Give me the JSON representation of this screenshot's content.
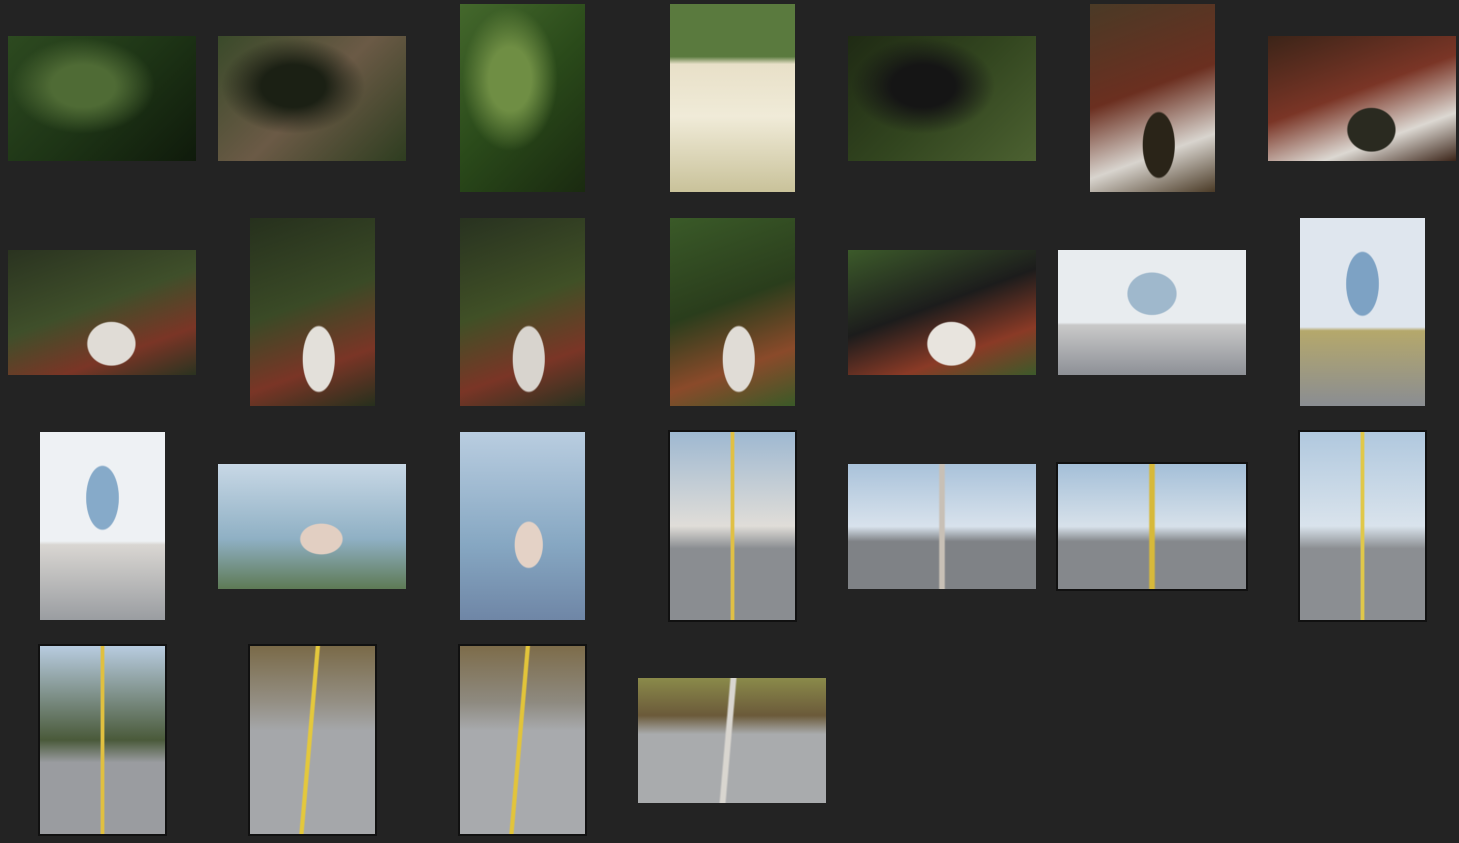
{
  "gallery": {
    "thumbnails": [
      {
        "orientation": "landscape",
        "scene": "garden",
        "colors": [
          "#2d4a20",
          "#1e3516",
          "#4f6b35",
          "#0f1a0b"
        ]
      },
      {
        "orientation": "landscape",
        "scene": "garden-couple",
        "colors": [
          "#3a4a2a",
          "#6b5a46",
          "#1b2014",
          "#2e3d20"
        ]
      },
      {
        "orientation": "portrait",
        "scene": "garden-trees",
        "colors": [
          "#44682c",
          "#2a4a1a",
          "#6f8e44",
          "#1a2a10"
        ]
      },
      {
        "orientation": "portrait",
        "scene": "blurred-foreground",
        "colors": [
          "#5a7a3e",
          "#e8e0c8",
          "#f0ebd8",
          "#c9c29a"
        ]
      },
      {
        "orientation": "landscape",
        "scene": "garden-couple",
        "colors": [
          "#1f2a14",
          "#32451f",
          "#151515",
          "#4c6131"
        ]
      },
      {
        "orientation": "portrait",
        "scene": "bench-bride",
        "colors": [
          "#4a3a26",
          "#6b2f20",
          "#d8d4ce",
          "#2a2418"
        ]
      },
      {
        "orientation": "landscape",
        "scene": "bench-bride",
        "colors": [
          "#3b2418",
          "#7a3526",
          "#dcd8d2",
          "#2a2a20"
        ]
      },
      {
        "orientation": "landscape",
        "scene": "wall-bench",
        "colors": [
          "#2a3320",
          "#3f4f2a",
          "#7a3526",
          "#e0dcd6"
        ]
      },
      {
        "orientation": "portrait",
        "scene": "wall-bench",
        "colors": [
          "#26301d",
          "#3a4a26",
          "#7a3526",
          "#e3e0da"
        ]
      },
      {
        "orientation": "portrait",
        "scene": "wall-bench-couple",
        "colors": [
          "#283220",
          "#405026",
          "#7a3526",
          "#d8d4ce"
        ]
      },
      {
        "orientation": "portrait",
        "scene": "bench-couple",
        "colors": [
          "#3a5a28",
          "#2a3d1c",
          "#8a4a2a",
          "#e0dcd6"
        ]
      },
      {
        "orientation": "landscape",
        "scene": "bench-couple",
        "colors": [
          "#3c5a2a",
          "#1c1c1c",
          "#8a3a26",
          "#e8e4de"
        ]
      },
      {
        "orientation": "landscape",
        "scene": "bridge-road",
        "colors": [
          "#e8ecef",
          "#9fb8cc",
          "#8d9096",
          "#c9c9c9"
        ]
      },
      {
        "orientation": "portrait",
        "scene": "bridge-road",
        "colors": [
          "#dfe6ee",
          "#7da2c4",
          "#8a8d92",
          "#b5a86b"
        ]
      },
      {
        "orientation": "portrait",
        "scene": "bridge-road",
        "colors": [
          "#eef1f4",
          "#86aac9",
          "#9a9da1",
          "#d9d6d2"
        ]
      },
      {
        "orientation": "landscape",
        "scene": "sea-couple",
        "colors": [
          "#c8d8e6",
          "#8fb0c4",
          "#e2cfc2",
          "#5e7a55"
        ]
      },
      {
        "orientation": "portrait",
        "scene": "sea-couple",
        "colors": [
          "#b9cde0",
          "#86a7c2",
          "#e4d2c6",
          "#6f86a6"
        ]
      },
      {
        "orientation": "portrait",
        "scene": "road-chair",
        "colors": [
          "#9eb8d1",
          "#e0ddd8",
          "#8a8d91",
          "#e0c045"
        ]
      },
      {
        "orientation": "landscape",
        "scene": "road-jump",
        "colors": [
          "#a9c2da",
          "#d8e2ec",
          "#7f8286",
          "#c8c0b6"
        ]
      },
      {
        "orientation": "landscape",
        "scene": "road-pose",
        "colors": [
          "#a4bfd8",
          "#d7e1ea",
          "#85888c",
          "#d7b93a"
        ]
      },
      {
        "orientation": "portrait",
        "scene": "road-couple",
        "colors": [
          "#b0c8de",
          "#d9e3ec",
          "#8b8e92",
          "#e0c84a"
        ]
      },
      {
        "orientation": "portrait",
        "scene": "road-yellow-line",
        "colors": [
          "#b8cce0",
          "#4a5a3a",
          "#9a9ca0",
          "#e0c040"
        ]
      },
      {
        "orientation": "portrait",
        "scene": "road-hill",
        "colors": [
          "#7a6a48",
          "#948f84",
          "#a5a7aa",
          "#e4c83c"
        ]
      },
      {
        "orientation": "portrait",
        "scene": "road-hill",
        "colors": [
          "#7d6c4a",
          "#8e8a80",
          "#a8aaad",
          "#e2c43a"
        ]
      },
      {
        "orientation": "landscape",
        "scene": "road-hill",
        "colors": [
          "#8a8a4a",
          "#6b5a3a",
          "#a9abad",
          "#d9d6d0"
        ]
      }
    ],
    "selected_indices": [
      17,
      19,
      20,
      21,
      22,
      23
    ]
  }
}
